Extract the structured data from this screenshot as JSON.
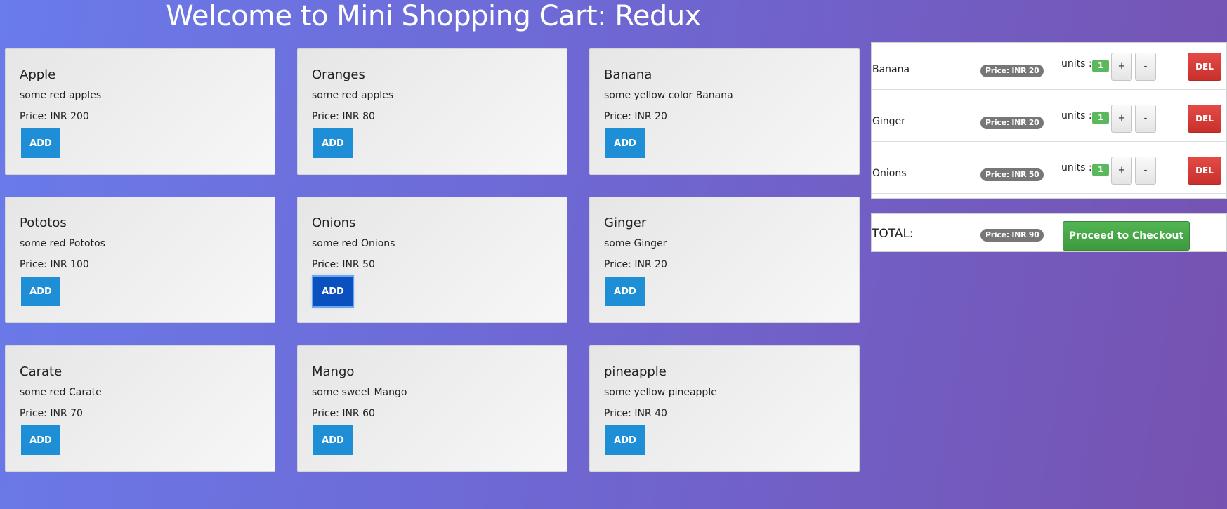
{
  "header": {
    "title": "Welcome to Mini Shopping Cart: Redux"
  },
  "products": [
    {
      "name": "Apple",
      "description": "some red apples",
      "price": "Price: INR 200",
      "add_label": "ADD"
    },
    {
      "name": "Oranges",
      "description": "some red apples",
      "price": "Price: INR 80",
      "add_label": "ADD"
    },
    {
      "name": "Banana",
      "description": "some yellow color Banana",
      "price": "Price: INR 20",
      "add_label": "ADD"
    },
    {
      "name": "Pototos",
      "description": "some red Pototos",
      "price": "Price: INR 100",
      "add_label": "ADD"
    },
    {
      "name": "Onions",
      "description": "some red Onions",
      "price": "Price: INR 50",
      "add_label": "ADD"
    },
    {
      "name": "Ginger",
      "description": "some Ginger",
      "price": "Price: INR 20",
      "add_label": "ADD"
    },
    {
      "name": "Carate",
      "description": "some red Carate",
      "price": "Price: INR 70",
      "add_label": "ADD"
    },
    {
      "name": "Mango",
      "description": "some sweet Mango",
      "price": "Price: INR 60",
      "add_label": "ADD"
    },
    {
      "name": "pineapple",
      "description": "some yellow pineapple",
      "price": "Price: INR 40",
      "add_label": "ADD"
    }
  ],
  "cart": {
    "items": [
      {
        "name": "Banana",
        "price": "Price: INR 20",
        "units_label": "units :",
        "units": "1",
        "plus": "+",
        "minus": "-",
        "del_label": "DEL"
      },
      {
        "name": "Ginger",
        "price": "Price: INR 20",
        "units_label": "units :",
        "units": "1",
        "plus": "+",
        "minus": "-",
        "del_label": "DEL"
      },
      {
        "name": "Onions",
        "price": "Price: INR 50",
        "units_label": "units :",
        "units": "1",
        "plus": "+",
        "minus": "-",
        "del_label": "DEL"
      }
    ],
    "total_label": "TOTAL:",
    "total_price": "Price: INR 90",
    "checkout_label": "Proceed to Checkout"
  },
  "colors": {
    "add_button": "#1e8fd6",
    "add_button_active": "#0b50bf",
    "units_badge": "#5cb85c",
    "price_pill": "#777777",
    "delete_button": "#d9534f",
    "checkout_button": "#4cae4c"
  }
}
